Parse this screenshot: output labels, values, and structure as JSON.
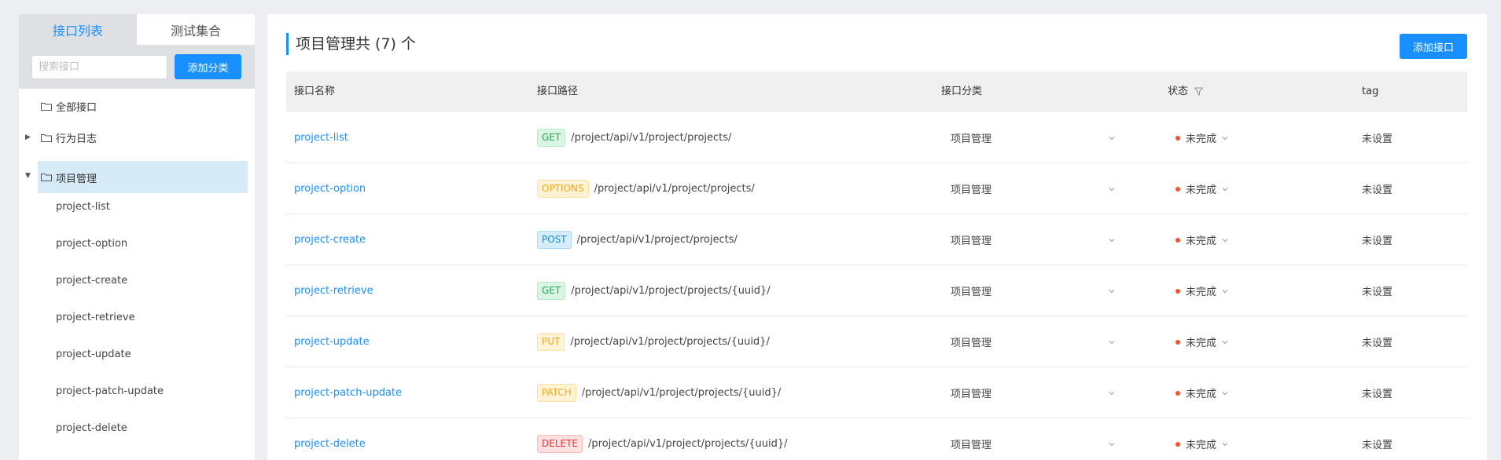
{
  "sidebar": {
    "tabs": [
      {
        "label": "接口列表",
        "active": true
      },
      {
        "label": "测试集合",
        "active": false
      }
    ],
    "search_placeholder": "搜索接口",
    "add_category_label": "添加分类",
    "tree": {
      "all": "全部接口",
      "categories": [
        {
          "label": "行为日志",
          "expanded": false
        },
        {
          "label": "项目管理",
          "expanded": true,
          "selected": true
        }
      ],
      "leaves": [
        "project-list",
        "project-option",
        "project-create",
        "project-retrieve",
        "project-update",
        "project-patch-update",
        "project-delete"
      ]
    }
  },
  "main": {
    "title": "项目管理共 (7) 个",
    "add_api_label": "添加接口",
    "columns": {
      "name": "接口名称",
      "path": "接口路径",
      "category": "接口分类",
      "status": "状态",
      "tag": "tag"
    },
    "rows": [
      {
        "name": "project-list",
        "method": "GET",
        "path": "/project/api/v1/project/projects/",
        "category": "项目管理",
        "status": "未完成",
        "tag": "未设置"
      },
      {
        "name": "project-option",
        "method": "OPTIONS",
        "path": "/project/api/v1/project/projects/",
        "category": "项目管理",
        "status": "未完成",
        "tag": "未设置"
      },
      {
        "name": "project-create",
        "method": "POST",
        "path": "/project/api/v1/project/projects/",
        "category": "项目管理",
        "status": "未完成",
        "tag": "未设置"
      },
      {
        "name": "project-retrieve",
        "method": "GET",
        "path": "/project/api/v1/project/projects/{uuid}/",
        "category": "项目管理",
        "status": "未完成",
        "tag": "未设置"
      },
      {
        "name": "project-update",
        "method": "PUT",
        "path": "/project/api/v1/project/projects/{uuid}/",
        "category": "项目管理",
        "status": "未完成",
        "tag": "未设置"
      },
      {
        "name": "project-patch-update",
        "method": "PATCH",
        "path": "/project/api/v1/project/projects/{uuid}/",
        "category": "项目管理",
        "status": "未完成",
        "tag": "未设置"
      },
      {
        "name": "project-delete",
        "method": "DELETE",
        "path": "/project/api/v1/project/projects/{uuid}/",
        "category": "项目管理",
        "status": "未完成",
        "tag": "未设置"
      }
    ]
  },
  "colors": {
    "accent": "#1890ff",
    "status_incomplete": "#f5532d",
    "method_get": {
      "bg": "#d9f5e3",
      "fg": "#2ea35a",
      "border": "#b7ebc8"
    },
    "method_options": {
      "bg": "#fff3d6",
      "fg": "#f2a71d",
      "border": "#ffe2a3"
    },
    "method_post": {
      "bg": "#d6eefb",
      "fg": "#1a8ad1",
      "border": "#a8dbf7"
    },
    "method_put": {
      "bg": "#fff3d6",
      "fg": "#f2a71d",
      "border": "#ffe2a3"
    },
    "method_patch": {
      "bg": "#fff3d6",
      "fg": "#f2a71d",
      "border": "#ffe2a3"
    },
    "method_delete": {
      "bg": "#fde1e1",
      "fg": "#e0383e",
      "border": "#f8b9b9"
    }
  },
  "icons": {
    "folder": "folder-icon",
    "caret_right": "caret-right-icon",
    "caret_down": "caret-down-icon",
    "filter": "filter-icon",
    "chevron_down": "chevron-down-icon"
  }
}
